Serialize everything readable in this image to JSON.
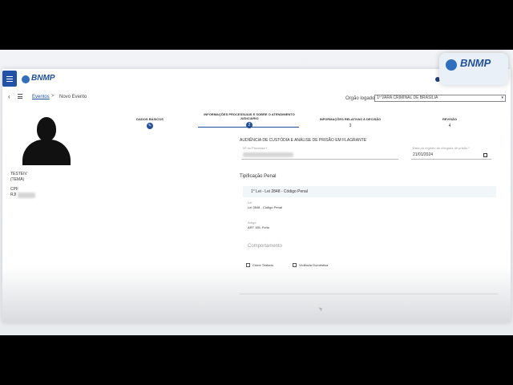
{
  "brand": {
    "name": "BNMP"
  },
  "crumbs": {
    "events": "Eventos",
    "separator": ">",
    "current": "Novo Evento"
  },
  "organ": {
    "label": "Orgão logado:",
    "value": "1ª VARA CRIMINAL DE BRASILIA"
  },
  "person": {
    "name": "TESTEIV",
    "mother_label": "(TEMA)",
    "cpf_label": "CPF",
    "rji_label": "RJI"
  },
  "steps": [
    {
      "label": "DADOS BÁSICOS",
      "number": ""
    },
    {
      "label": "INFORMAÇÕES PROCESSUAIS E SOBRE O ATENDIMENTO JUDICIÁRIO",
      "number": "2"
    },
    {
      "label": "INFORMAÇÕES RELATIVAS À DECISÃO",
      "number": "3"
    },
    {
      "label": "REVISÃO",
      "number": "4"
    }
  ],
  "form": {
    "section_title": "AUDIÊNCIA DE CUSTÓDIA E ANÁLISE DE PRISÃO EM FLAGRANTE",
    "process_label": "Nº do Processo *",
    "date_label": "Data do registro de chegada de prisão *",
    "date_value": "21/01/2024",
    "tipificacao_title": "Tipificação Penal",
    "tip_header": "1° Lei - Lei 2848 - Código Penal",
    "lei_label": "Lei",
    "lei_value": "Lei 2848 - Código Penal",
    "artigo_label": "Artigo",
    "artigo_value": "ART 155, Furto",
    "comportamento_title": "Comportamento",
    "chk_tentado": "Crime Tentado",
    "chk_violencia": "Violência Doméstica"
  }
}
